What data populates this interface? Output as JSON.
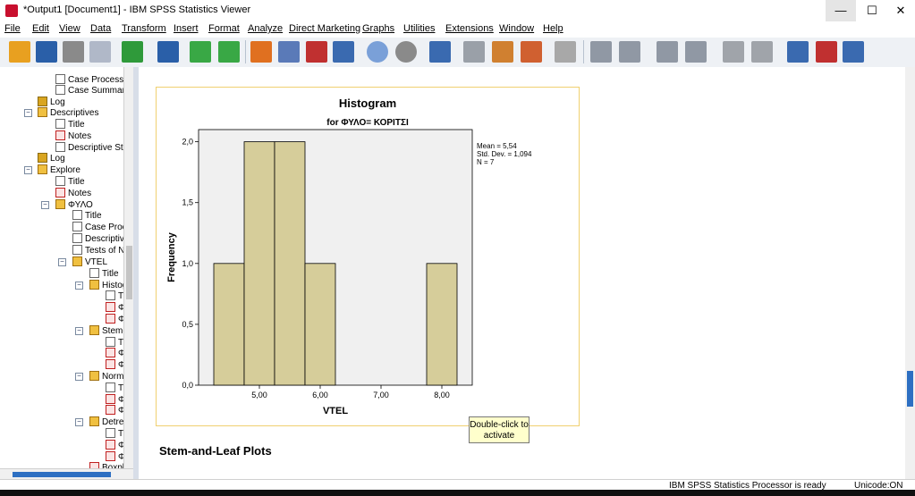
{
  "window": {
    "title": "*Output1 [Document1] - IBM SPSS Statistics Viewer",
    "minimize": "—",
    "maximize": "☐",
    "close": "✕"
  },
  "menu": [
    "File",
    "Edit",
    "View",
    "Data",
    "Transform",
    "Insert",
    "Format",
    "Analyze",
    "Direct Marketing",
    "Graphs",
    "Utilities",
    "Extensions",
    "Window",
    "Help"
  ],
  "tree": {
    "items": [
      {
        "label": "Case Processi",
        "icon": "table-icon"
      },
      {
        "label": "Case Summari",
        "icon": "table-icon"
      },
      {
        "label": "Log",
        "icon": "book-icon"
      },
      {
        "label": "Descriptives",
        "icon": "folder-icon"
      },
      {
        "label": "Title",
        "icon": "table-icon"
      },
      {
        "label": "Notes",
        "icon": "notes-icon"
      },
      {
        "label": "Descriptive Sta",
        "icon": "table-icon"
      },
      {
        "label": "Log",
        "icon": "book-icon"
      },
      {
        "label": "Explore",
        "icon": "folder-icon"
      },
      {
        "label": "Title",
        "icon": "table-icon"
      },
      {
        "label": "Notes",
        "icon": "notes-icon"
      },
      {
        "label": "ΦΥΛΟ",
        "icon": "folder-icon"
      },
      {
        "label": "Title",
        "icon": "table-icon"
      },
      {
        "label": "Case Proc",
        "icon": "table-icon"
      },
      {
        "label": "Descriptive",
        "icon": "table-icon"
      },
      {
        "label": "Tests of N",
        "icon": "table-icon"
      },
      {
        "label": "VTEL",
        "icon": "folder-icon"
      },
      {
        "label": "Title",
        "icon": "table-icon"
      },
      {
        "label": "Histog",
        "icon": "folder-icon"
      },
      {
        "label": "T",
        "icon": "table-icon"
      },
      {
        "label": "Φ",
        "icon": "chart-icon"
      },
      {
        "label": "Φ",
        "icon": "chart-icon"
      },
      {
        "label": "Stem-",
        "icon": "folder-icon"
      },
      {
        "label": "T",
        "icon": "table-icon"
      },
      {
        "label": "Φ",
        "icon": "chart-icon"
      },
      {
        "label": "Φ",
        "icon": "chart-icon"
      },
      {
        "label": "Norma",
        "icon": "folder-icon"
      },
      {
        "label": "T",
        "icon": "table-icon"
      },
      {
        "label": "Φ",
        "icon": "chart-icon"
      },
      {
        "label": "Φ",
        "icon": "chart-icon"
      },
      {
        "label": "Detren",
        "icon": "folder-icon"
      },
      {
        "label": "T",
        "icon": "table-icon"
      },
      {
        "label": "Φ",
        "icon": "chart-icon"
      },
      {
        "label": "Φ",
        "icon": "chart-icon"
      },
      {
        "label": "Boxplo",
        "icon": "chart-icon"
      }
    ]
  },
  "output": {
    "tooltip_line1": "Double-click to",
    "tooltip_line2": "activate",
    "next_section": "Stem-and-Leaf Plots"
  },
  "chart_data": {
    "type": "bar",
    "title": "Histogram",
    "subtitle": "for ΦΥΛΟ= ΚΟΡΙΤΣΙ",
    "xlabel": "VTEL",
    "ylabel": "Frequency",
    "bins": [
      {
        "from": 4.25,
        "to": 4.75,
        "value": 1
      },
      {
        "from": 4.75,
        "to": 5.25,
        "value": 2
      },
      {
        "from": 5.25,
        "to": 5.75,
        "value": 2
      },
      {
        "from": 5.75,
        "to": 6.25,
        "value": 1
      },
      {
        "from": 7.75,
        "to": 8.25,
        "value": 1
      }
    ],
    "xlim": [
      4.0,
      8.5
    ],
    "ylim": [
      0,
      2.1
    ],
    "xticks": [
      5,
      6,
      7,
      8
    ],
    "xtick_labels": [
      "5,00",
      "6,00",
      "7,00",
      "8,00"
    ],
    "yticks": [
      0,
      0.5,
      1,
      1.5,
      2
    ],
    "ytick_labels": [
      "0,0",
      "0,5",
      "1,0",
      "1,5",
      "2,0"
    ],
    "stats": [
      "Mean = 5,54",
      "Std. Dev. = 1,094",
      "N = 7"
    ],
    "bar_color": "#d6cd9a",
    "plot_bg": "#f0f0f0"
  },
  "status": {
    "processor": "IBM SPSS Statistics Processor is ready",
    "unicode": "Unicode:ON"
  }
}
